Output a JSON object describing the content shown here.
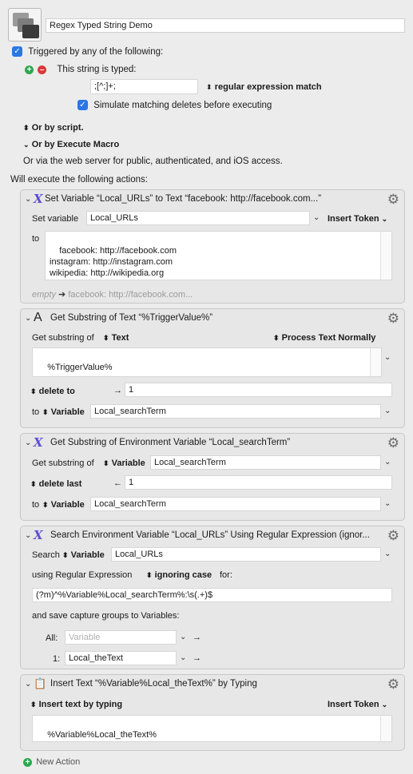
{
  "macro": {
    "name": "Regex Typed String Demo",
    "trigger_header": "Triggered by any of the following:",
    "trigger_label": "This string is typed:",
    "typed_string": ";[^;]+;",
    "match_mode": "regular expression match",
    "simulate_label": "Simulate matching deletes before executing",
    "or_script": "Or by script.",
    "or_execute": "Or by Execute Macro",
    "or_web": "Or via the web server for public, authenticated, and iOS access.",
    "will_execute": "Will execute the following actions:",
    "new_action": "New Action"
  },
  "actions": [
    {
      "title": "Set Variable “Local_URLs” to Text “facebook: http://facebook.com...”",
      "set_variable_label": "Set variable",
      "variable": "Local_URLs",
      "insert_token": "Insert Token",
      "to_label": "to",
      "text_lines": "facebook: http://facebook.com\ninstagram: http://instagram.com\nwikipedia: http://wikipedia.org\nyoutube: http://youtube.com",
      "preview_empty": "empty",
      "preview_value": "facebook: http://facebook.com..."
    },
    {
      "title": "Get Substring of Text “%TriggerValue%”",
      "get_label": "Get substring of",
      "source_type": "Text",
      "process_text": "Process Text Normally",
      "text": "%TriggerValue%",
      "delete_to": "delete to",
      "delete_arrow": "→",
      "number": "1",
      "to_label": "to",
      "target_type": "Variable",
      "target": "Local_searchTerm"
    },
    {
      "title": "Get Substring of Environment Variable “Local_searchTerm”",
      "get_label": "Get substring of",
      "source_type": "Variable",
      "source": "Local_searchTerm",
      "delete_last": "delete last",
      "delete_arrow": "←",
      "number": "1",
      "to_label": "to",
      "target_type": "Variable",
      "target": "Local_searchTerm"
    },
    {
      "title": "Search Environment Variable “Local_URLs” Using Regular Expression (ignor...",
      "search_label": "Search",
      "source_type": "Variable",
      "source": "Local_URLs",
      "using_label": "using Regular Expression",
      "case_mode": "ignoring case",
      "for_label": "for:",
      "regex": "(?m)^%Variable%Local_searchTerm%:\\s(.+)$",
      "save_label": "and save capture groups to Variables:",
      "all_label": "All:",
      "all_placeholder": "Variable",
      "group1_label": "1:",
      "group1_value": "Local_theText",
      "arrow": "→"
    },
    {
      "title": "Insert Text “%Variable%Local_theText%” by Typing",
      "mode": "Insert text by typing",
      "insert_token": "Insert Token",
      "text": "%Variable%Local_theText%"
    }
  ]
}
